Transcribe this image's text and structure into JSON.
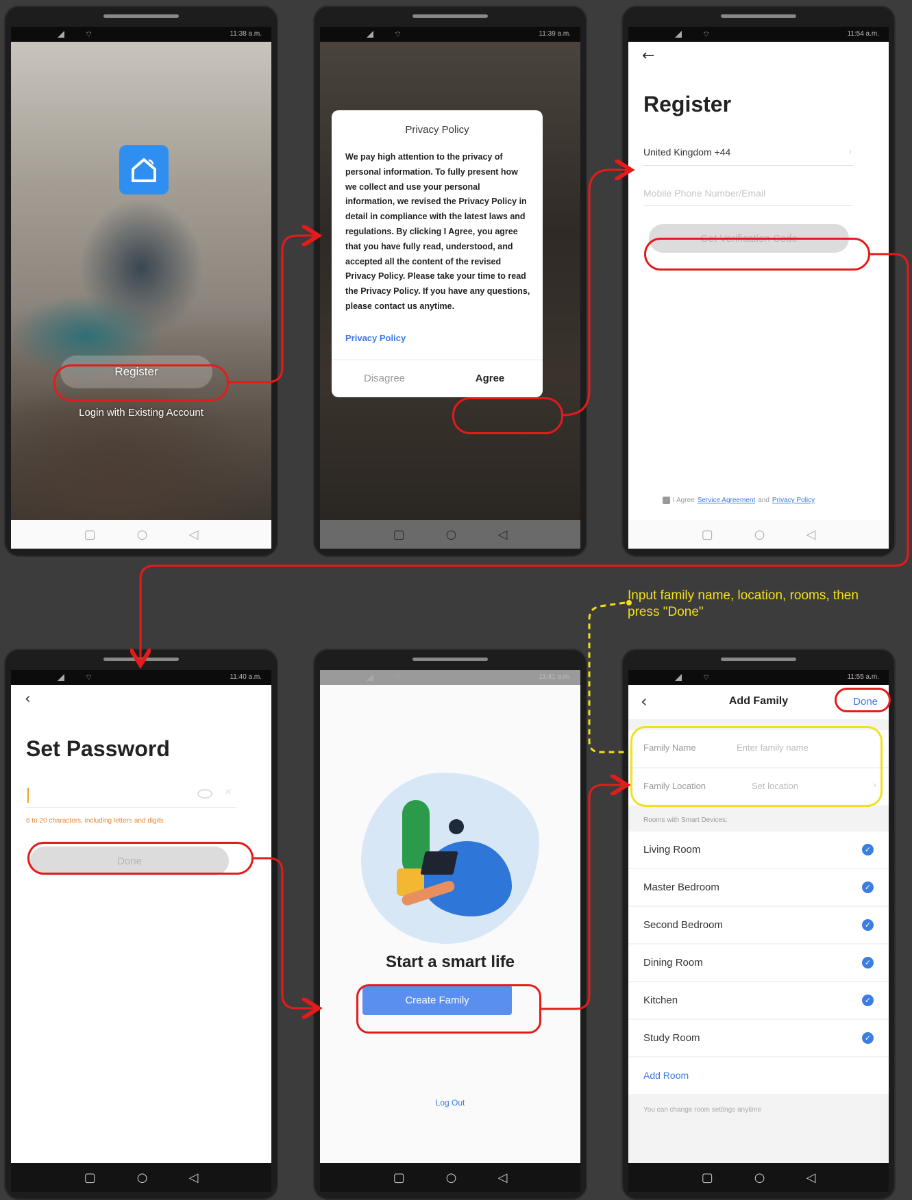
{
  "status_times": [
    "11:38 a.m.",
    "11:39 a.m.",
    "11:54 a.m.",
    "11:40 a.m.",
    "11:41 a.m.",
    "11:55 a.m."
  ],
  "screen1": {
    "register_label": "Register",
    "login_label": "Login with Existing Account"
  },
  "screen2": {
    "title": "Privacy Policy",
    "body": "We pay high attention to the privacy of personal information. To fully present how we collect and use your personal information, we revised the Privacy Policy in detail in compliance with the latest laws and regulations. By clicking I Agree, you agree that you have fully read, understood, and accepted all the content of the revised Privacy Policy. Please take your time to read the Privacy Policy. If you have any questions, please contact us anytime.",
    "link": "Privacy Policy",
    "disagree": "Disagree",
    "agree": "Agree"
  },
  "screen3": {
    "title": "Register",
    "country": "United Kingdom +44",
    "phone_placeholder": "Mobile Phone Number/Email",
    "get_code": "Get Verification Code",
    "agree_prefix": "I Agree",
    "service_agreement": "Service Agreement",
    "and": "and",
    "privacy_policy": "Privacy Policy"
  },
  "screen4": {
    "title": "Set Password",
    "hint": "6 to 20 characters, including letters and digits",
    "done": "Done"
  },
  "screen5": {
    "title": "Start a smart life",
    "create_family": "Create Family",
    "logout": "Log Out"
  },
  "screen6": {
    "header_title": "Add Family",
    "done": "Done",
    "family_name_label": "Family Name",
    "family_name_placeholder": "Enter family name",
    "family_location_label": "Family Location",
    "family_location_placeholder": "Set location",
    "rooms_header": "Rooms with Smart Devices:",
    "rooms": [
      "Living Room",
      "Master Bedroom",
      "Second Bedroom",
      "Dining Room",
      "Kitchen",
      "Study Room"
    ],
    "add_room": "Add Room",
    "footer_note": "You can change room settings anytime"
  },
  "annotation": {
    "instruction": "Input family name, location, rooms, then press \"Done\""
  },
  "colors": {
    "highlight_red": "#e51b1b",
    "highlight_yellow": "#f3e01a",
    "accent_blue": "#3b78e7"
  }
}
